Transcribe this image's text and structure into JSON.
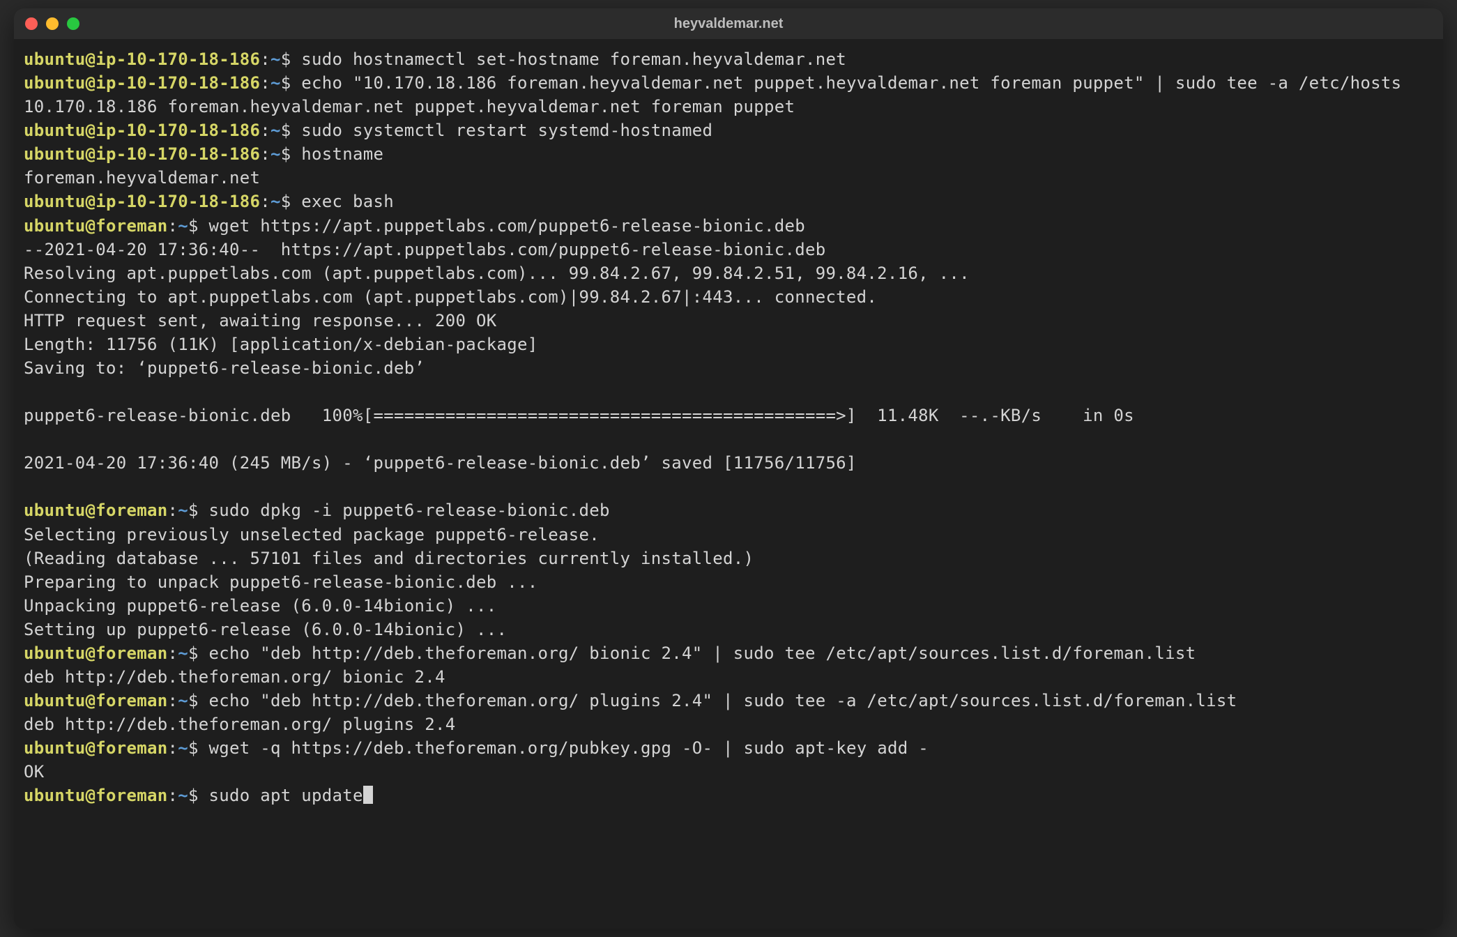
{
  "window": {
    "title": "heyvaldemar.net"
  },
  "prompt1": {
    "userhost": "ubuntu@ip-10-170-18-186",
    "colon": ":",
    "path": "~",
    "dollar": "$ "
  },
  "prompt2": {
    "userhost": "ubuntu@foreman",
    "colon": ":",
    "path": "~",
    "dollar": "$ "
  },
  "lines": {
    "cmd1": "sudo hostnamectl set-hostname foreman.heyvaldemar.net",
    "cmd2": "echo \"10.170.18.186 foreman.heyvaldemar.net puppet.heyvaldemar.net foreman puppet\" | sudo tee -a /etc/hosts",
    "out2": "10.170.18.186 foreman.heyvaldemar.net puppet.heyvaldemar.net foreman puppet",
    "cmd3": "sudo systemctl restart systemd-hostnamed",
    "cmd4": "hostname",
    "out4": "foreman.heyvaldemar.net",
    "cmd5": "exec bash",
    "cmd6": "wget https://apt.puppetlabs.com/puppet6-release-bionic.deb",
    "out6a": "--2021-04-20 17:36:40--  https://apt.puppetlabs.com/puppet6-release-bionic.deb",
    "out6b": "Resolving apt.puppetlabs.com (apt.puppetlabs.com)... 99.84.2.67, 99.84.2.51, 99.84.2.16, ...",
    "out6c": "Connecting to apt.puppetlabs.com (apt.puppetlabs.com)|99.84.2.67|:443... connected.",
    "out6d": "HTTP request sent, awaiting response... 200 OK",
    "out6e": "Length: 11756 (11K) [application/x-debian-package]",
    "out6f": "Saving to: ‘puppet6-release-bionic.deb’",
    "out6g": "puppet6-release-bionic.deb   100%[=============================================>]  11.48K  --.-KB/s    in 0s",
    "out6h": "2021-04-20 17:36:40 (245 MB/s) - ‘puppet6-release-bionic.deb’ saved [11756/11756]",
    "cmd7": "sudo dpkg -i puppet6-release-bionic.deb",
    "out7a": "Selecting previously unselected package puppet6-release.",
    "out7b": "(Reading database ... 57101 files and directories currently installed.)",
    "out7c": "Preparing to unpack puppet6-release-bionic.deb ...",
    "out7d": "Unpacking puppet6-release (6.0.0-14bionic) ...",
    "out7e": "Setting up puppet6-release (6.0.0-14bionic) ...",
    "cmd8": "echo \"deb http://deb.theforeman.org/ bionic 2.4\" | sudo tee /etc/apt/sources.list.d/foreman.list",
    "out8": "deb http://deb.theforeman.org/ bionic 2.4",
    "cmd9": "echo \"deb http://deb.theforeman.org/ plugins 2.4\" | sudo tee -a /etc/apt/sources.list.d/foreman.list",
    "out9": "deb http://deb.theforeman.org/ plugins 2.4",
    "cmd10": "wget -q https://deb.theforeman.org/pubkey.gpg -O- | sudo apt-key add -",
    "out10": "OK",
    "cmd11": "sudo apt update"
  }
}
